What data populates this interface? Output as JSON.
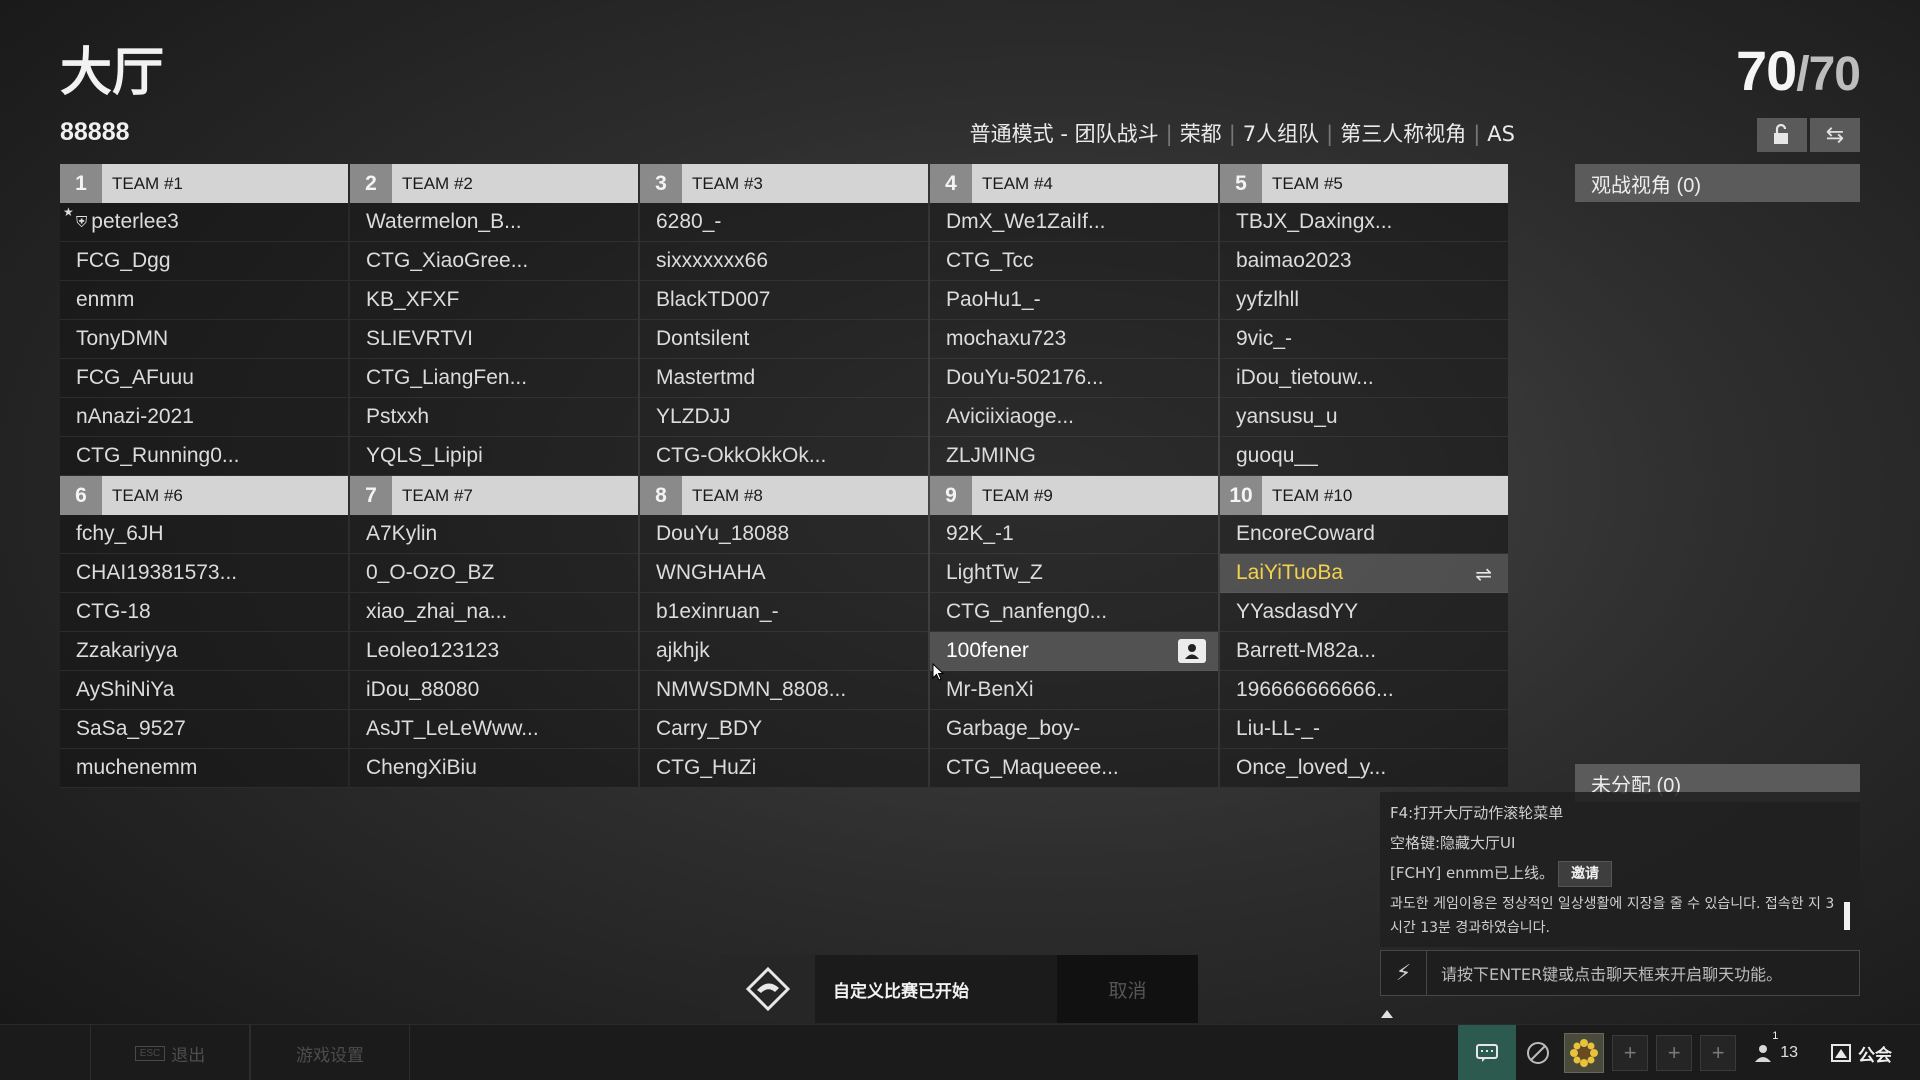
{
  "lobby": {
    "title": "大厅",
    "room_id": "88888",
    "player_count": "70",
    "player_max": "/70",
    "mode": "普通模式 - 团队战斗",
    "map": "荣都",
    "squad": "7人组队",
    "perspective": "第三人称视角",
    "region": "AS"
  },
  "teams": [
    {
      "num": "1",
      "name": "TEAM #1",
      "players": [
        "peterlee3",
        "FCG_Dgg",
        "enmm",
        "TonyDMN",
        "FCG_AFuuu",
        "nAnazi-2021",
        "CTG_Running0..."
      ]
    },
    {
      "num": "2",
      "name": "TEAM #2",
      "players": [
        "Watermelon_B...",
        "CTG_XiaoGree...",
        "KB_XFXF",
        "SLIEVRTVI",
        "CTG_LiangFen...",
        "Pstxxh",
        "YQLS_Lipipi"
      ]
    },
    {
      "num": "3",
      "name": "TEAM #3",
      "players": [
        "6280_-",
        "sixxxxxxx66",
        "BlackTD007",
        "Dontsilent",
        "Mastertmd",
        "YLZDJJ",
        "CTG-OkkOkkOk..."
      ]
    },
    {
      "num": "4",
      "name": "TEAM #4",
      "players": [
        "DmX_We1ZaiIf...",
        "CTG_Tcc",
        "PaoHu1_-",
        "mochaxu723",
        "DouYu-502176...",
        "Aviciixiaoge...",
        "ZLJMING"
      ]
    },
    {
      "num": "5",
      "name": "TEAM #5",
      "players": [
        "TBJX_Daxingx...",
        "baimao2023",
        "yyfzlhll",
        "9vic_-",
        "iDou_tietouw...",
        "yansusu_u",
        "guoqu__"
      ]
    },
    {
      "num": "6",
      "name": "TEAM #6",
      "players": [
        "fchy_6JH",
        "CHAI19381573...",
        "CTG-18",
        "Zzakariyya",
        "AyShiNiYa",
        "SaSa_9527",
        "muchenemm"
      ]
    },
    {
      "num": "7",
      "name": "TEAM #7",
      "players": [
        "A7Kylin",
        "0_O-OzO_BZ",
        "xiao_zhai_na...",
        "Leoleo123123",
        "iDou_88080",
        "AsJT_LeLeWww...",
        "ChengXiBiu"
      ]
    },
    {
      "num": "8",
      "name": "TEAM #8",
      "players": [
        "DouYu_18088",
        "WNGHAHA",
        "b1exinruan_-",
        "ajkhjk",
        "NMWSDMN_8808...",
        "Carry_BDY",
        "CTG_HuZi"
      ]
    },
    {
      "num": "9",
      "name": "TEAM #9",
      "players": [
        "92K_-1",
        "LightTw_Z",
        "CTG_nanfeng0...",
        "100fener",
        "Mr-BenXi",
        "Garbage_boy-",
        "CTG_Maqueeee..."
      ]
    },
    {
      "num": "10",
      "name": "TEAM #10",
      "players": [
        "EncoreCoward",
        "LaiYiTuoBa",
        "YYasdasdYY",
        "Barrett-M82a...",
        "196666666666...",
        "Liu-LL-_-",
        "Once_loved_y..."
      ]
    }
  ],
  "side": {
    "spectator": "观战视角 (0)",
    "unassigned": "未分配 (0)"
  },
  "chat": {
    "line1": "F4:打开大厅动作滚轮菜单",
    "line2": "空格键:隐藏大厅UI",
    "line3": "[FCHY] enmm已上线。",
    "invite": "邀请",
    "line4": "과도한 게임이용은 정상적인 일상생활에 지장을 줄 수 있습니다. 접속한 지 3시간 13분 경과하였습니다.",
    "placeholder": "请按下ENTER键或点击聊天框来开启聊天功能。"
  },
  "toast": {
    "message": "自定义比赛已开始",
    "cancel": "取消"
  },
  "bottom": {
    "esc_key": "ESC",
    "exit": "退出",
    "settings": "游戏设置",
    "friends_count": "13",
    "friends_badge": "1",
    "clan": "公会"
  },
  "colors": {
    "self_name": "#f4d24a",
    "chat_active": "#2d5a4e"
  }
}
